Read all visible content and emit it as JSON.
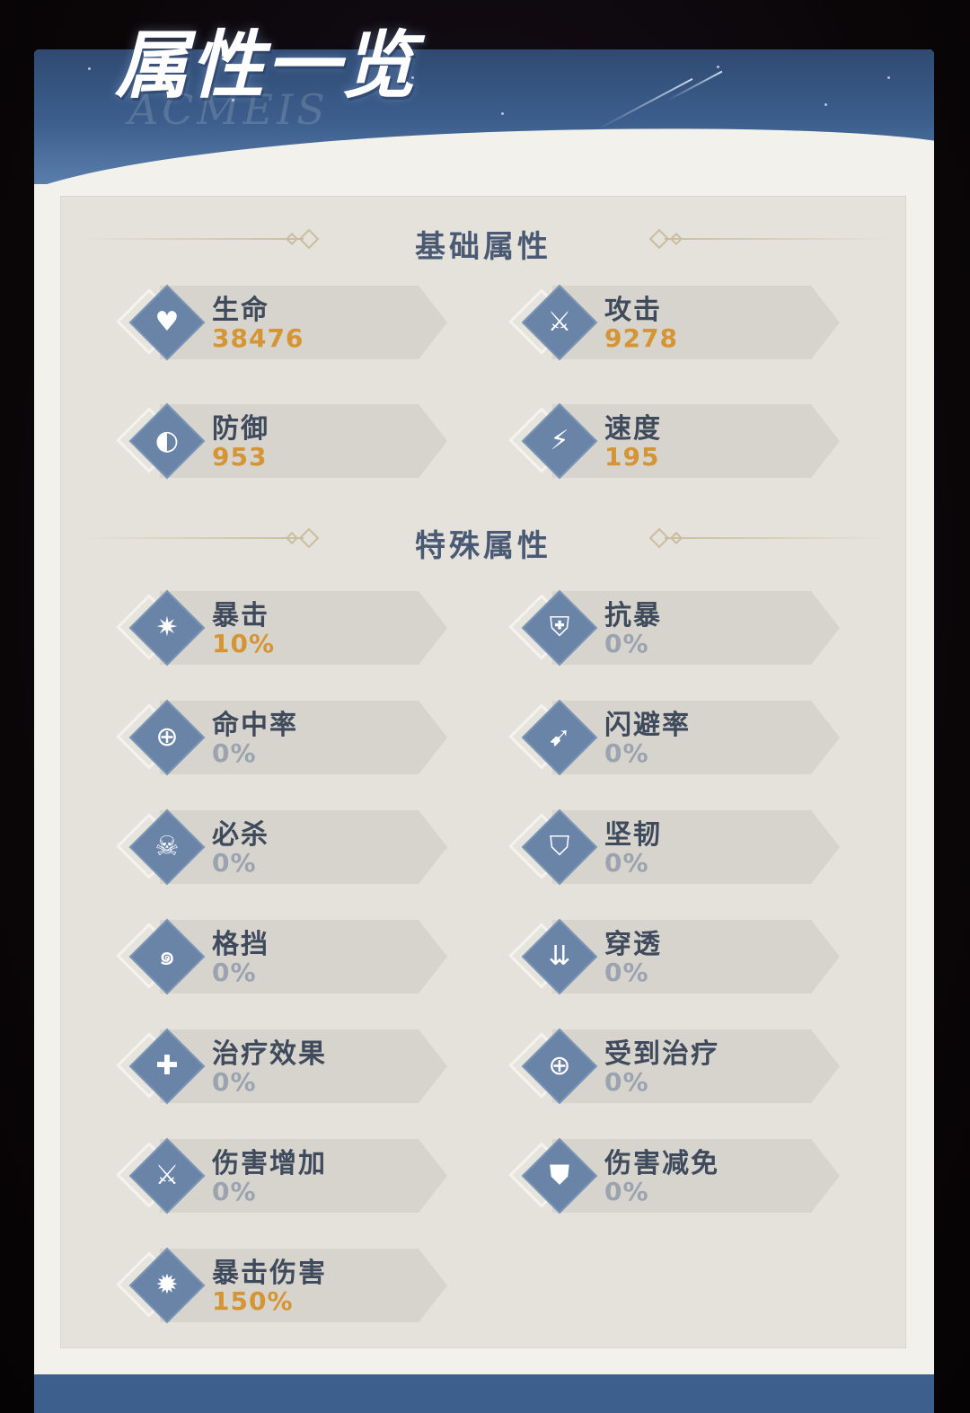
{
  "title": "属性一览",
  "title_watermark": "ACMEIS",
  "colors": {
    "header_blue": "#3d5f8e",
    "icon_blue": "#6a84a8",
    "value_orange": "#d69535",
    "value_gray": "#9ba3b0"
  },
  "sections": {
    "basic": {
      "label": "基础属性",
      "stats": [
        {
          "name": "生命",
          "value": "38476",
          "icon": "heart-icon",
          "glyph": "♥",
          "highlight": true
        },
        {
          "name": "攻击",
          "value": "9278",
          "icon": "sword-icon",
          "glyph": "⚔",
          "highlight": true
        },
        {
          "name": "防御",
          "value": "953",
          "icon": "shield-icon",
          "glyph": "◐",
          "highlight": true
        },
        {
          "name": "速度",
          "value": "195",
          "icon": "lightning-icon",
          "glyph": "⚡",
          "highlight": true
        }
      ]
    },
    "special": {
      "label": "特殊属性",
      "stats": [
        {
          "name": "暴击",
          "value": "10%",
          "icon": "critical-hit-icon",
          "glyph": "✷",
          "highlight": true
        },
        {
          "name": "抗暴",
          "value": "0%",
          "icon": "crit-resist-shield-icon",
          "glyph": "⛨",
          "highlight": false
        },
        {
          "name": "命中率",
          "value": "0%",
          "icon": "crosshair-icon",
          "glyph": "⊕",
          "highlight": false
        },
        {
          "name": "闪避率",
          "value": "0%",
          "icon": "dodge-runner-icon",
          "glyph": "➹",
          "highlight": false
        },
        {
          "name": "必杀",
          "value": "0%",
          "icon": "skull-icon",
          "glyph": "☠",
          "highlight": false
        },
        {
          "name": "坚韧",
          "value": "0%",
          "icon": "tenacity-shield-icon",
          "glyph": "⛉",
          "highlight": false
        },
        {
          "name": "格挡",
          "value": "0%",
          "icon": "block-swirl-icon",
          "glyph": "๑",
          "highlight": false
        },
        {
          "name": "穿透",
          "value": "0%",
          "icon": "penetration-blade-icon",
          "glyph": "⇊",
          "highlight": false
        },
        {
          "name": "治疗效果",
          "value": "0%",
          "icon": "heal-plus-up-icon",
          "glyph": "✚",
          "highlight": false
        },
        {
          "name": "受到治疗",
          "value": "0%",
          "icon": "heal-received-icon",
          "glyph": "⊕",
          "highlight": false
        },
        {
          "name": "伤害增加",
          "value": "0%",
          "icon": "damage-up-sword-icon",
          "glyph": "⚔",
          "highlight": false
        },
        {
          "name": "伤害减免",
          "value": "0%",
          "icon": "damage-reduction-shield-icon",
          "glyph": "⛊",
          "highlight": false
        },
        {
          "name": "暴击伤害",
          "value": "150%",
          "icon": "crit-damage-icon",
          "glyph": "✹",
          "highlight": true
        }
      ]
    }
  }
}
